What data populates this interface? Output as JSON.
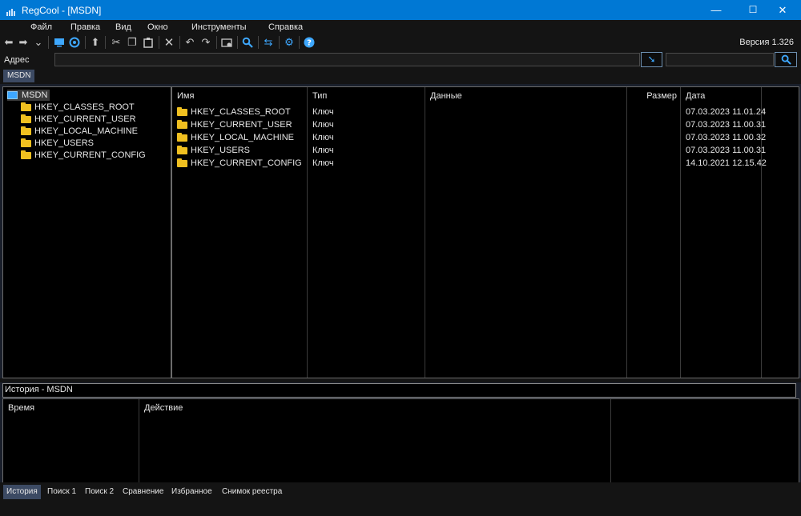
{
  "window": {
    "title": "RegCool - [MSDN]",
    "controls": [
      "—",
      "☐",
      "✕"
    ],
    "accent": "#0078d4"
  },
  "menu": [
    "Файл",
    "Правка",
    "Вид",
    "Окно",
    "Инструменты",
    "Справка"
  ],
  "toolbar": {
    "version": "Версия 1.326",
    "icons": [
      "back-arrow-icon",
      "forward-arrow-icon",
      "chevron-down-icon",
      "computer-icon",
      "connect-icon",
      "up-arrow-icon",
      "cut-icon",
      "copy-icon",
      "paste-icon",
      "delete-icon",
      "undo-icon",
      "redo-icon",
      "new-key-icon",
      "find-icon",
      "refresh-icon",
      "settings-icon",
      "help-icon"
    ]
  },
  "address": {
    "label": "Адрес",
    "value": "",
    "search_value": ""
  },
  "tabs": [
    "MSDN"
  ],
  "tree": {
    "root": "MSDN",
    "items": [
      "HKEY_CLASSES_ROOT",
      "HKEY_CURRENT_USER",
      "HKEY_LOCAL_MACHINE",
      "HKEY_USERS",
      "HKEY_CURRENT_CONFIG"
    ]
  },
  "list": {
    "columns": [
      "Имя",
      "Тип",
      "Данные",
      "Размер",
      "Дата"
    ],
    "rows": [
      {
        "name": "HKEY_CLASSES_ROOT",
        "type": "Ключ",
        "data": "",
        "size": "",
        "date": "07.03.2023 11.01.24"
      },
      {
        "name": "HKEY_CURRENT_USER",
        "type": "Ключ",
        "data": "",
        "size": "",
        "date": "07.03.2023 11.00.31"
      },
      {
        "name": "HKEY_LOCAL_MACHINE",
        "type": "Ключ",
        "data": "",
        "size": "",
        "date": "07.03.2023 11.00.32"
      },
      {
        "name": "HKEY_USERS",
        "type": "Ключ",
        "data": "",
        "size": "",
        "date": "07.03.2023 11.00.31"
      },
      {
        "name": "HKEY_CURRENT_CONFIG",
        "type": "Ключ",
        "data": "",
        "size": "",
        "date": "14.10.2021 12.15.42"
      }
    ]
  },
  "history": {
    "title": "История - MSDN",
    "columns": [
      "Время",
      "Действие"
    ]
  },
  "bottom_tabs": [
    "История",
    "Поиск 1",
    "Поиск 2",
    "Сравнение",
    "Избранное",
    "Снимок реестра"
  ]
}
